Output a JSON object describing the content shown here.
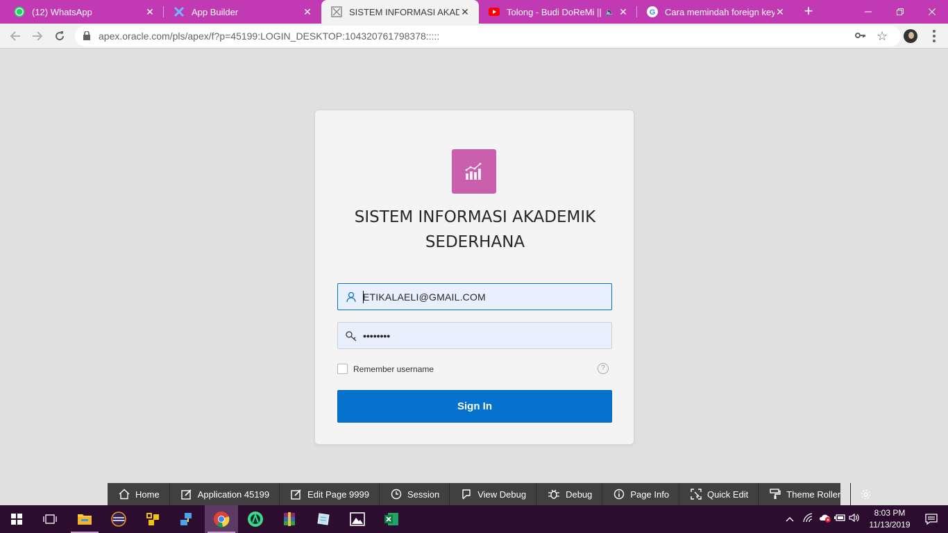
{
  "browser": {
    "tabs": [
      {
        "title": "(12) WhatsApp",
        "icon": "whatsapp-icon"
      },
      {
        "title": "App Builder",
        "icon": "apex-icon"
      },
      {
        "title": "SISTEM INFORMASI AKADEMIK",
        "icon": "apex-app-icon"
      },
      {
        "title": "Tolong - Budi DoReMi || Co",
        "icon": "youtube-icon"
      },
      {
        "title": "Cara memindah foreign key - ",
        "icon": "google-icon"
      }
    ],
    "url": "apex.oracle.com/pls/apex/f?p=45199:LOGIN_DESKTOP:104320761798378:::::"
  },
  "login": {
    "title_line1": "SISTEM INFORMASI AKADEMIK",
    "title_line2": "SEDERHANA",
    "username": "ETIKALAELI@GMAIL.COM",
    "password_mask": "••••••••",
    "remember_label": "Remember username",
    "help_symbol": "?",
    "sign_in_label": "Sign In"
  },
  "dev_toolbar": {
    "items": [
      {
        "label": "Home",
        "icon": "home-icon"
      },
      {
        "label": "Application 45199",
        "icon": "edit-app-icon"
      },
      {
        "label": "Edit Page 9999",
        "icon": "edit-page-icon"
      },
      {
        "label": "Session",
        "icon": "clock-icon"
      },
      {
        "label": "View Debug",
        "icon": "view-debug-icon"
      },
      {
        "label": "Debug",
        "icon": "bug-icon"
      },
      {
        "label": "Page Info",
        "icon": "info-icon"
      },
      {
        "label": "Quick Edit",
        "icon": "quick-edit-icon"
      },
      {
        "label": "Theme Roller",
        "icon": "paint-roller-icon"
      }
    ]
  },
  "taskbar": {
    "time": "8:03 PM",
    "date": "11/13/2019"
  },
  "colors": {
    "tab_strip": "#c13ab3",
    "sign_in_button": "#0572ce",
    "app_logo": "#c95fad",
    "taskbar": "#2c0d2f"
  }
}
